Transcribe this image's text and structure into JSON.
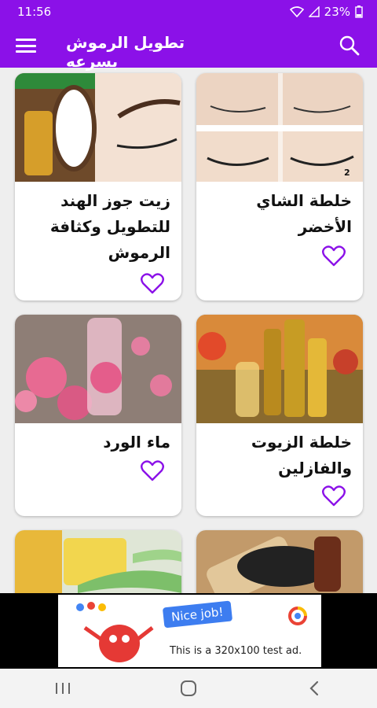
{
  "status_bar": {
    "time": "11:56",
    "battery": "23%"
  },
  "app_bar": {
    "title": "تطويل الرموش بسرعه"
  },
  "cards": [
    {
      "title": "خلطة الشاي الأخضر"
    },
    {
      "title": "زيت جوز الهند للتطويل وكثافة الرموش"
    },
    {
      "title": "خلطة الزيوت والفازلين"
    },
    {
      "title": "ماء الورد"
    },
    {
      "title": ""
    },
    {
      "title": ""
    }
  ],
  "ad": {
    "badge": "Nice job!",
    "text": "This is a 320x100 test ad."
  },
  "colors": {
    "primary": "#8b11e8",
    "accent": "#8b11e8"
  }
}
